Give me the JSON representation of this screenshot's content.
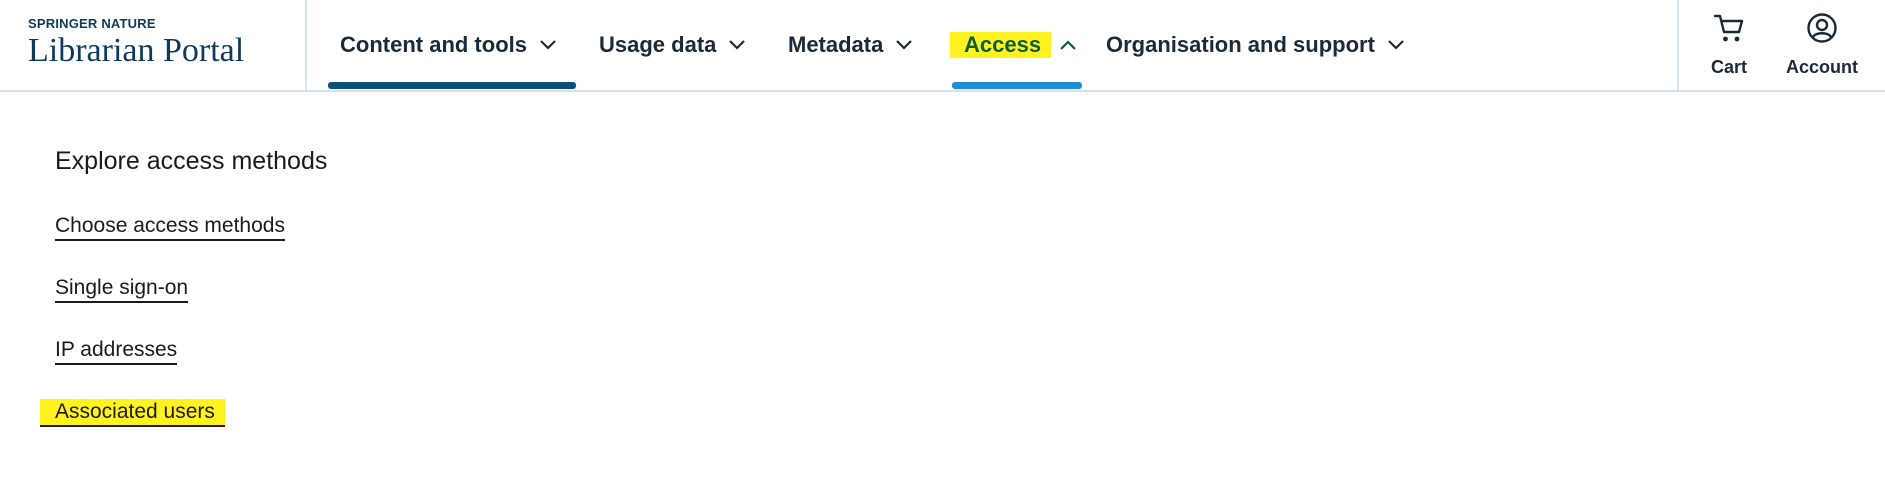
{
  "brand": {
    "sub": "SPRINGER NATURE",
    "title": "Librarian Portal"
  },
  "nav": {
    "items": [
      {
        "label": "Content and tools"
      },
      {
        "label": "Usage data"
      },
      {
        "label": "Metadata"
      },
      {
        "label": "Access"
      },
      {
        "label": "Organisation and support"
      }
    ]
  },
  "utility": {
    "cart_label": "Cart",
    "account_label": "Account"
  },
  "panel": {
    "title": "Explore access methods",
    "links": [
      {
        "label": "Choose access methods"
      },
      {
        "label": "Single sign-on"
      },
      {
        "label": "IP addresses"
      },
      {
        "label": "Associated users"
      }
    ]
  },
  "colors": {
    "brand": "#0e3a5b",
    "highlight": "#fff21f",
    "active_text": "#0b5e3a",
    "underline_dark": "#0e4f7a",
    "underline_light": "#1f8dd6"
  }
}
